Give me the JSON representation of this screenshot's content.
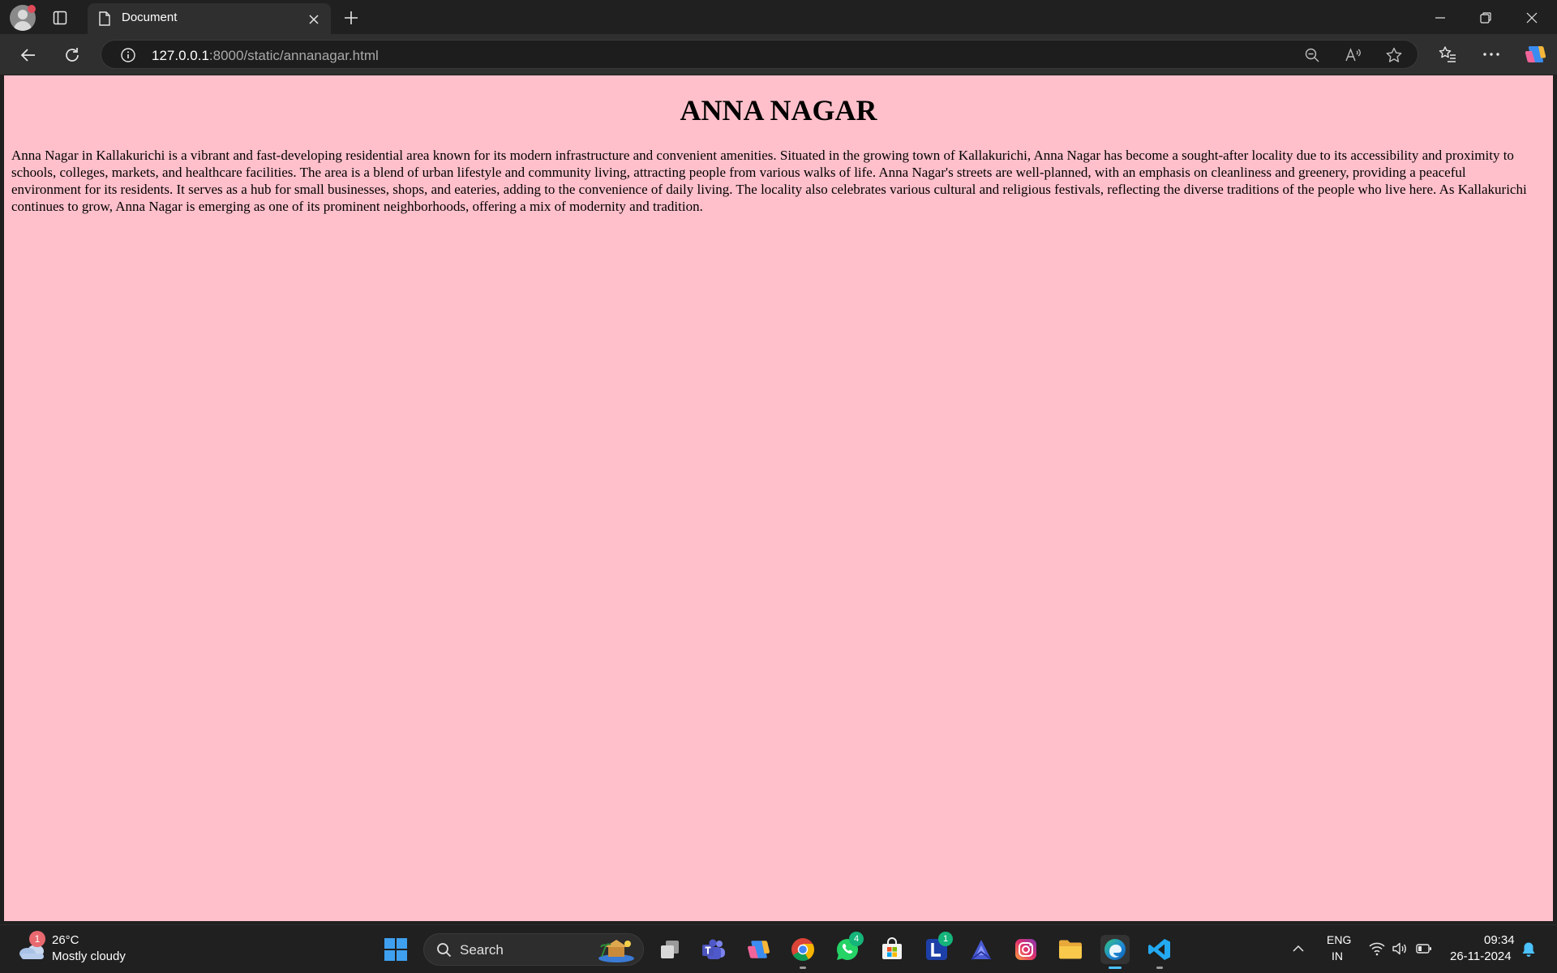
{
  "browser": {
    "tab_title": "Document",
    "url_host": "127.0.0.1",
    "url_rest": ":8000/static/annanagar.html"
  },
  "page": {
    "background": "#ffc0cb",
    "heading": "ANNA NAGAR",
    "paragraph": "Anna Nagar in Kallakurichi is a vibrant and fast-developing residential area known for its modern infrastructure and convenient amenities. Situated in the growing town of Kallakurichi, Anna Nagar has become a sought-after locality due to its accessibility and proximity to schools, colleges, markets, and healthcare facilities. The area is a blend of urban lifestyle and community living, attracting people from various walks of life. Anna Nagar's streets are well-planned, with an emphasis on cleanliness and greenery, providing a peaceful environment for its residents. It serves as a hub for small businesses, shops, and eateries, adding to the convenience of daily living. The locality also celebrates various cultural and religious festivals, reflecting the diverse traditions of the people who live here. As Kallakurichi continues to grow, Anna Nagar is emerging as one of its prominent neighborhoods, offering a mix of modernity and tradition."
  },
  "taskbar": {
    "weather_badge": "1",
    "weather_temp": "26°C",
    "weather_desc": "Mostly cloudy",
    "search_label": "Search",
    "apps": [
      {
        "name": "task-view",
        "icon": "task-view-icon"
      },
      {
        "name": "teams",
        "icon": "teams-icon"
      },
      {
        "name": "copilot",
        "icon": "copilot-icon"
      },
      {
        "name": "chrome",
        "icon": "chrome-icon"
      },
      {
        "name": "whatsapp",
        "icon": "whatsapp-icon",
        "badge": "4"
      },
      {
        "name": "store",
        "icon": "store-icon"
      },
      {
        "name": "l-app",
        "icon": "l-app-icon",
        "badge": "1"
      },
      {
        "name": "proton",
        "icon": "proton-icon"
      },
      {
        "name": "instagram",
        "icon": "instagram-icon"
      },
      {
        "name": "file-explorer",
        "icon": "folder-icon"
      },
      {
        "name": "edge",
        "icon": "edge-icon"
      },
      {
        "name": "vscode",
        "icon": "vscode-icon"
      }
    ],
    "lang_line1": "ENG",
    "lang_line2": "IN",
    "time": "09:34",
    "date": "26-11-2024"
  }
}
